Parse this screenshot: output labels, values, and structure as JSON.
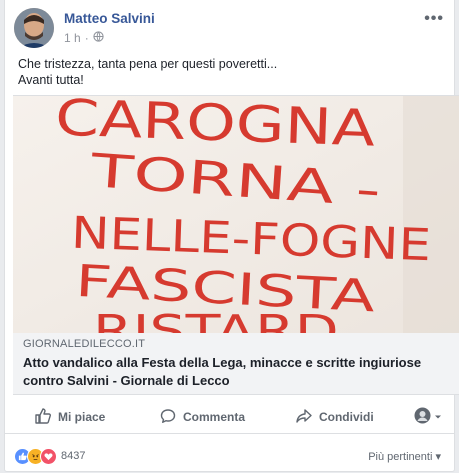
{
  "post": {
    "author": "Matteo Salvini",
    "time": "1 h",
    "privacy_icon": "globe-icon",
    "text_line1": "Che tristezza, tanta pena per questi poveretti...",
    "text_line2": "Avanti tutta!"
  },
  "image": {
    "handwritten_lines": [
      "CAROGNA",
      "TORNA -",
      "NELLE-FOGNE",
      "FASCISTA",
      "RISTARD..."
    ],
    "ink_color": "#d63a2f"
  },
  "link": {
    "domain": "GIORNALEDILECCO.IT",
    "title": "Atto vandalico alla Festa della Lega, minacce e scritte ingiuriose contro Salvini - Giornale di Lecco"
  },
  "actions": {
    "like_label": "Mi piace",
    "comment_label": "Commenta",
    "share_label": "Condividi"
  },
  "stats": {
    "reactions_count": "8437",
    "sort_label": "Più pertinenti"
  },
  "colors": {
    "author": "#385898",
    "like_blue": "#5890ff",
    "angry_orange": "#f7b125",
    "love_red": "#f25268"
  }
}
